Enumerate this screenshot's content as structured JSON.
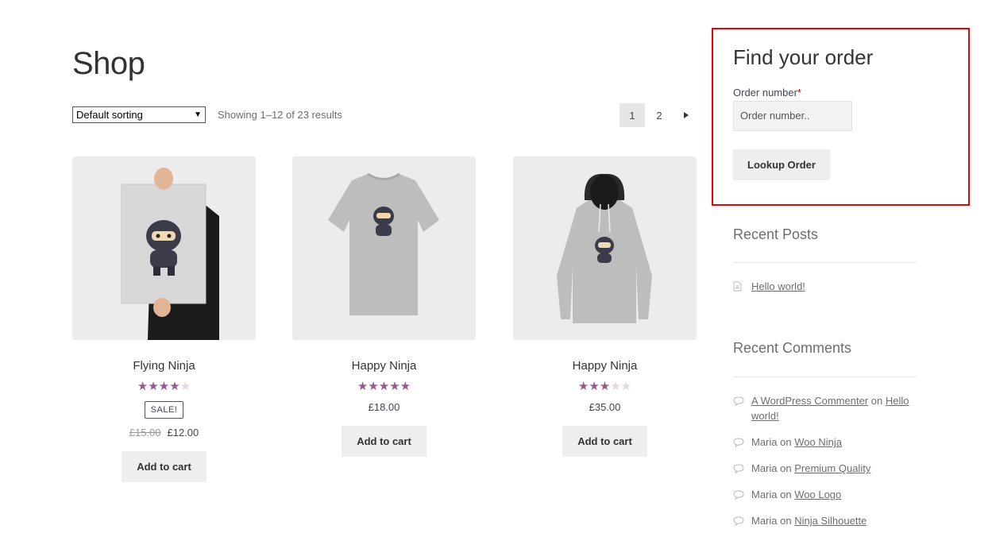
{
  "page": {
    "title": "Shop"
  },
  "toolbar": {
    "sorting": "Default sorting",
    "result_count": "Showing 1–12 of 23 results",
    "pages": [
      "1",
      "2"
    ]
  },
  "products": [
    {
      "name": "Flying Ninja",
      "rating": 4,
      "sale_badge": "SALE!",
      "old_price": "£15.00",
      "price": "£12.00",
      "button": "Add to cart"
    },
    {
      "name": "Happy Ninja",
      "rating": 5,
      "price": "£18.00",
      "button": "Add to cart"
    },
    {
      "name": "Happy Ninja",
      "rating": 3,
      "price": "£35.00",
      "button": "Add to cart"
    }
  ],
  "order_lookup": {
    "title": "Find your order",
    "label": "Order number",
    "required_mark": "*",
    "placeholder": "Order number..",
    "button": "Lookup Order"
  },
  "recent_posts": {
    "title": "Recent Posts",
    "items": [
      "Hello world!"
    ]
  },
  "recent_comments": {
    "title": "Recent Comments",
    "connector": "on",
    "items": [
      {
        "author": "A WordPress Commenter",
        "post": "Hello world!"
      },
      {
        "author": "Maria",
        "post": "Woo Ninja"
      },
      {
        "author": "Maria",
        "post": "Premium Quality"
      },
      {
        "author": "Maria",
        "post": "Woo Logo"
      },
      {
        "author": "Maria",
        "post": "Ninja Silhouette"
      }
    ]
  },
  "colors": {
    "accent": "#96588a",
    "highlight_border": "#e00000"
  }
}
